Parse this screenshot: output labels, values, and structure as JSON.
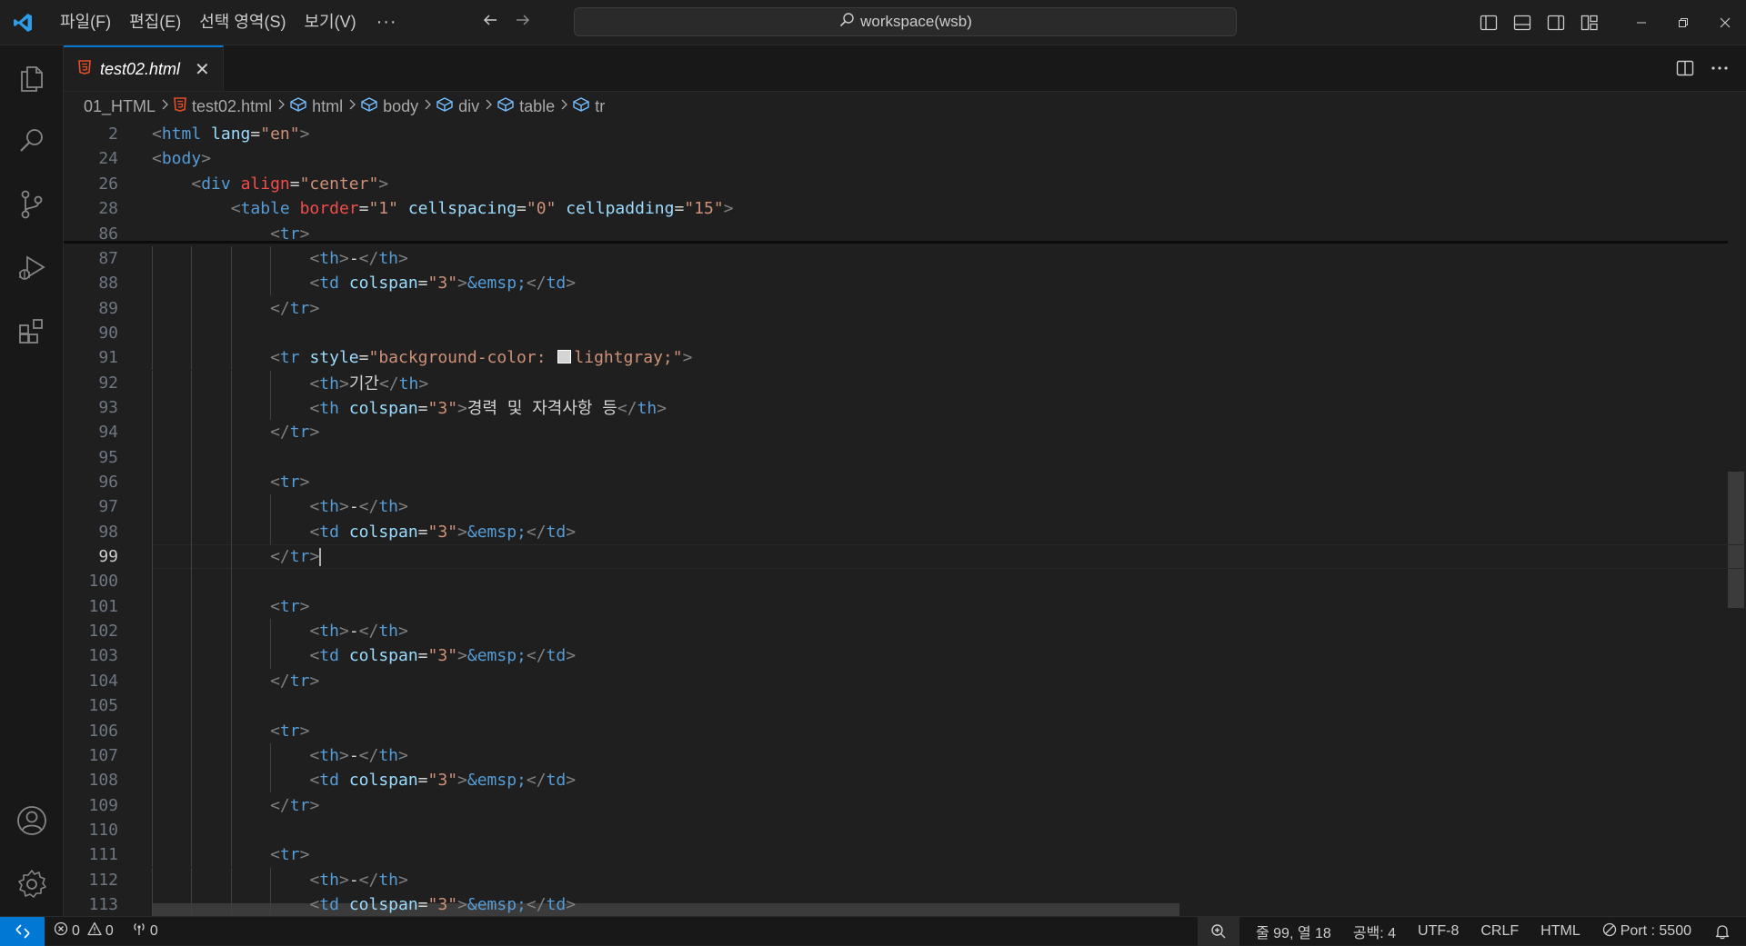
{
  "title_bar": {
    "menu": [
      "파일(F)",
      "편집(E)",
      "선택 영역(S)",
      "보기(V)"
    ],
    "more": "···",
    "search": "workspace(wsb)"
  },
  "tabs": [
    {
      "label": "test02.html",
      "close": "✕"
    }
  ],
  "breadcrumb": [
    "01_HTML",
    "test02.html",
    "html",
    "body",
    "div",
    "table",
    "tr"
  ],
  "editor": {
    "lines": [
      {
        "n": "2",
        "indent": 0,
        "tokens": [
          [
            "b",
            "<"
          ],
          [
            "t",
            "html"
          ],
          [
            "s",
            " "
          ],
          [
            "a",
            "lang"
          ],
          [
            "p",
            "="
          ],
          [
            "v",
            "\"en\""
          ],
          [
            "b",
            ">"
          ]
        ]
      },
      {
        "n": "24",
        "indent": 0,
        "tokens": [
          [
            "b",
            "<"
          ],
          [
            "t",
            "body"
          ],
          [
            "b",
            ">"
          ]
        ]
      },
      {
        "n": "26",
        "indent": 1,
        "tokens": [
          [
            "b",
            "<"
          ],
          [
            "t",
            "div"
          ],
          [
            "s",
            " "
          ],
          [
            "r",
            "align"
          ],
          [
            "p",
            "="
          ],
          [
            "v",
            "\"center\""
          ],
          [
            "b",
            ">"
          ]
        ]
      },
      {
        "n": "28",
        "indent": 2,
        "tokens": [
          [
            "b",
            "<"
          ],
          [
            "t",
            "table"
          ],
          [
            "s",
            " "
          ],
          [
            "r",
            "border"
          ],
          [
            "p",
            "="
          ],
          [
            "v",
            "\"1\""
          ],
          [
            "s",
            " "
          ],
          [
            "a",
            "cellspacing"
          ],
          [
            "p",
            "="
          ],
          [
            "v",
            "\"0\""
          ],
          [
            "s",
            " "
          ],
          [
            "a",
            "cellpadding"
          ],
          [
            "p",
            "="
          ],
          [
            "v",
            "\"15\""
          ],
          [
            "b",
            ">"
          ]
        ]
      },
      {
        "n": "86",
        "indent": 3,
        "tokens": [
          [
            "b",
            "<"
          ],
          [
            "t",
            "tr"
          ],
          [
            "b",
            ">"
          ]
        ]
      },
      {
        "n": "87",
        "indent": 4,
        "tokens": [
          [
            "b",
            "<"
          ],
          [
            "t",
            "th"
          ],
          [
            "b",
            ">"
          ],
          [
            "x",
            "-"
          ],
          [
            "b",
            "</"
          ],
          [
            "t",
            "th"
          ],
          [
            "b",
            ">"
          ]
        ]
      },
      {
        "n": "88",
        "indent": 4,
        "tokens": [
          [
            "b",
            "<"
          ],
          [
            "t",
            "td"
          ],
          [
            "s",
            " "
          ],
          [
            "a",
            "colspan"
          ],
          [
            "p",
            "="
          ],
          [
            "v",
            "\"3\""
          ],
          [
            "b",
            ">"
          ],
          [
            "e",
            "&emsp;"
          ],
          [
            "b",
            "</"
          ],
          [
            "t",
            "td"
          ],
          [
            "b",
            ">"
          ]
        ]
      },
      {
        "n": "89",
        "indent": 3,
        "tokens": [
          [
            "b",
            "</"
          ],
          [
            "t",
            "tr"
          ],
          [
            "b",
            ">"
          ]
        ]
      },
      {
        "n": "90",
        "indent": 0,
        "tokens": []
      },
      {
        "n": "91",
        "indent": 3,
        "tokens": [
          [
            "b",
            "<"
          ],
          [
            "t",
            "tr"
          ],
          [
            "s",
            " "
          ],
          [
            "a",
            "style"
          ],
          [
            "p",
            "="
          ],
          [
            "v",
            "\"background-color: "
          ],
          [
            "c",
            ""
          ],
          [
            "v",
            "lightgray;\""
          ],
          [
            "b",
            ">"
          ]
        ]
      },
      {
        "n": "92",
        "indent": 4,
        "tokens": [
          [
            "b",
            "<"
          ],
          [
            "t",
            "th"
          ],
          [
            "b",
            ">"
          ],
          [
            "x",
            "기간"
          ],
          [
            "b",
            "</"
          ],
          [
            "t",
            "th"
          ],
          [
            "b",
            ">"
          ]
        ]
      },
      {
        "n": "93",
        "indent": 4,
        "tokens": [
          [
            "b",
            "<"
          ],
          [
            "t",
            "th"
          ],
          [
            "s",
            " "
          ],
          [
            "a",
            "colspan"
          ],
          [
            "p",
            "="
          ],
          [
            "v",
            "\"3\""
          ],
          [
            "b",
            ">"
          ],
          [
            "x",
            "경력 및 자격사항 등"
          ],
          [
            "b",
            "</"
          ],
          [
            "t",
            "th"
          ],
          [
            "b",
            ">"
          ]
        ]
      },
      {
        "n": "94",
        "indent": 3,
        "tokens": [
          [
            "b",
            "</"
          ],
          [
            "t",
            "tr"
          ],
          [
            "b",
            ">"
          ]
        ]
      },
      {
        "n": "95",
        "indent": 0,
        "tokens": []
      },
      {
        "n": "96",
        "indent": 3,
        "tokens": [
          [
            "b",
            "<"
          ],
          [
            "t",
            "tr"
          ],
          [
            "b",
            ">"
          ]
        ]
      },
      {
        "n": "97",
        "indent": 4,
        "tokens": [
          [
            "b",
            "<"
          ],
          [
            "t",
            "th"
          ],
          [
            "b",
            ">"
          ],
          [
            "x",
            "-"
          ],
          [
            "b",
            "</"
          ],
          [
            "t",
            "th"
          ],
          [
            "b",
            ">"
          ]
        ]
      },
      {
        "n": "98",
        "indent": 4,
        "tokens": [
          [
            "b",
            "<"
          ],
          [
            "t",
            "td"
          ],
          [
            "s",
            " "
          ],
          [
            "a",
            "colspan"
          ],
          [
            "p",
            "="
          ],
          [
            "v",
            "\"3\""
          ],
          [
            "b",
            ">"
          ],
          [
            "e",
            "&emsp;"
          ],
          [
            "b",
            "</"
          ],
          [
            "t",
            "td"
          ],
          [
            "b",
            ">"
          ]
        ]
      },
      {
        "n": "99",
        "indent": 3,
        "tokens": [
          [
            "b",
            "</"
          ],
          [
            "t",
            "tr"
          ],
          [
            "b",
            ">"
          ],
          [
            "k",
            ""
          ]
        ],
        "active": true
      },
      {
        "n": "100",
        "indent": 0,
        "tokens": []
      },
      {
        "n": "101",
        "indent": 3,
        "tokens": [
          [
            "b",
            "<"
          ],
          [
            "t",
            "tr"
          ],
          [
            "b",
            ">"
          ]
        ]
      },
      {
        "n": "102",
        "indent": 4,
        "tokens": [
          [
            "b",
            "<"
          ],
          [
            "t",
            "th"
          ],
          [
            "b",
            ">"
          ],
          [
            "x",
            "-"
          ],
          [
            "b",
            "</"
          ],
          [
            "t",
            "th"
          ],
          [
            "b",
            ">"
          ]
        ]
      },
      {
        "n": "103",
        "indent": 4,
        "tokens": [
          [
            "b",
            "<"
          ],
          [
            "t",
            "td"
          ],
          [
            "s",
            " "
          ],
          [
            "a",
            "colspan"
          ],
          [
            "p",
            "="
          ],
          [
            "v",
            "\"3\""
          ],
          [
            "b",
            ">"
          ],
          [
            "e",
            "&emsp;"
          ],
          [
            "b",
            "</"
          ],
          [
            "t",
            "td"
          ],
          [
            "b",
            ">"
          ]
        ]
      },
      {
        "n": "104",
        "indent": 3,
        "tokens": [
          [
            "b",
            "</"
          ],
          [
            "t",
            "tr"
          ],
          [
            "b",
            ">"
          ]
        ]
      },
      {
        "n": "105",
        "indent": 0,
        "tokens": []
      },
      {
        "n": "106",
        "indent": 3,
        "tokens": [
          [
            "b",
            "<"
          ],
          [
            "t",
            "tr"
          ],
          [
            "b",
            ">"
          ]
        ]
      },
      {
        "n": "107",
        "indent": 4,
        "tokens": [
          [
            "b",
            "<"
          ],
          [
            "t",
            "th"
          ],
          [
            "b",
            ">"
          ],
          [
            "x",
            "-"
          ],
          [
            "b",
            "</"
          ],
          [
            "t",
            "th"
          ],
          [
            "b",
            ">"
          ]
        ]
      },
      {
        "n": "108",
        "indent": 4,
        "tokens": [
          [
            "b",
            "<"
          ],
          [
            "t",
            "td"
          ],
          [
            "s",
            " "
          ],
          [
            "a",
            "colspan"
          ],
          [
            "p",
            "="
          ],
          [
            "v",
            "\"3\""
          ],
          [
            "b",
            ">"
          ],
          [
            "e",
            "&emsp;"
          ],
          [
            "b",
            "</"
          ],
          [
            "t",
            "td"
          ],
          [
            "b",
            ">"
          ]
        ]
      },
      {
        "n": "109",
        "indent": 3,
        "tokens": [
          [
            "b",
            "</"
          ],
          [
            "t",
            "tr"
          ],
          [
            "b",
            ">"
          ]
        ]
      },
      {
        "n": "110",
        "indent": 0,
        "tokens": []
      },
      {
        "n": "111",
        "indent": 3,
        "tokens": [
          [
            "b",
            "<"
          ],
          [
            "t",
            "tr"
          ],
          [
            "b",
            ">"
          ]
        ]
      },
      {
        "n": "112",
        "indent": 4,
        "tokens": [
          [
            "b",
            "<"
          ],
          [
            "t",
            "th"
          ],
          [
            "b",
            ">"
          ],
          [
            "x",
            "-"
          ],
          [
            "b",
            "</"
          ],
          [
            "t",
            "th"
          ],
          [
            "b",
            ">"
          ]
        ]
      },
      {
        "n": "113",
        "indent": 4,
        "tokens": [
          [
            "b",
            "<"
          ],
          [
            "t",
            "td"
          ],
          [
            "s",
            " "
          ],
          [
            "a",
            "colspan"
          ],
          [
            "p",
            "="
          ],
          [
            "v",
            "\"3\""
          ],
          [
            "b",
            ">"
          ],
          [
            "e",
            "&emsp;"
          ],
          [
            "b",
            "</"
          ],
          [
            "t",
            "td"
          ],
          [
            "b",
            ">"
          ]
        ]
      }
    ]
  },
  "status_bar": {
    "errors": "0",
    "warnings": "0",
    "ports": "0",
    "cursor_position": "줄 99, 열 18",
    "indentation": "공백: 4",
    "encoding": "UTF-8",
    "line_ending": "CRLF",
    "language": "HTML",
    "live_server": "Port : 5500"
  },
  "colors": {
    "accent": "#0078d4",
    "html_file_icon": "#e44d26"
  }
}
